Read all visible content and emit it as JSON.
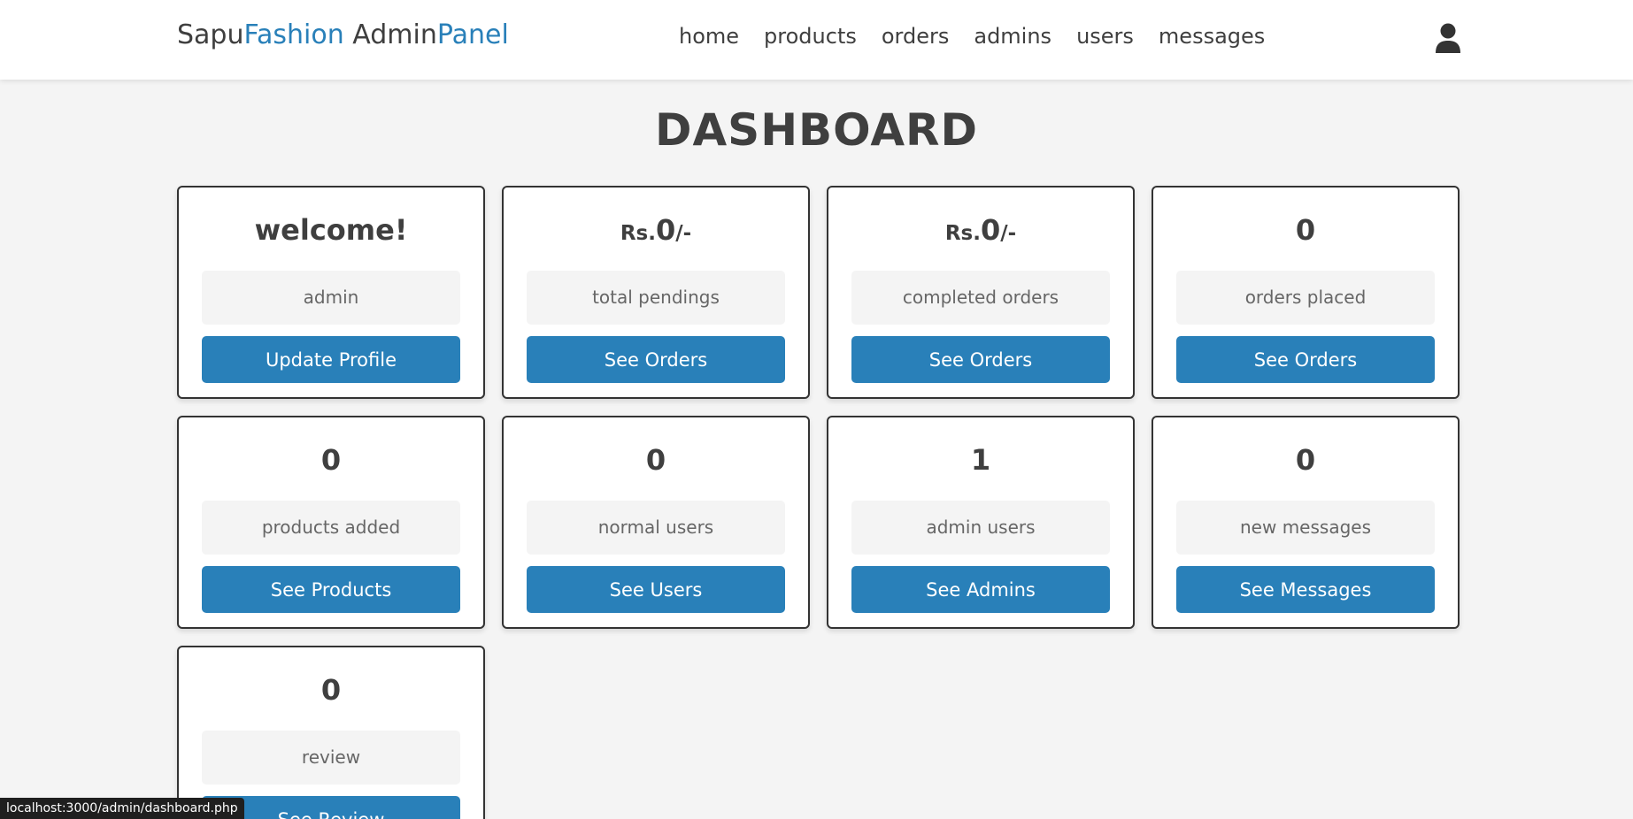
{
  "header": {
    "logo": {
      "part1": "Sapu",
      "part2": "Fashion",
      "part3": " Admin",
      "part4": "Panel"
    },
    "nav": [
      "home",
      "products",
      "orders",
      "admins",
      "users",
      "messages"
    ],
    "user_icon": "user-icon"
  },
  "page_title": "DASHBOARD",
  "cards": [
    {
      "value": "welcome!",
      "label": "admin",
      "button": "Update Profile"
    },
    {
      "prefix": "Rs.",
      "value": "0",
      "suffix": "/-",
      "label": "total pendings",
      "button": "See Orders"
    },
    {
      "prefix": "Rs.",
      "value": "0",
      "suffix": "/-",
      "label": "completed orders",
      "button": "See Orders"
    },
    {
      "value": "0",
      "label": "orders placed",
      "button": "See Orders"
    },
    {
      "value": "0",
      "label": "products added",
      "button": "See Products"
    },
    {
      "value": "0",
      "label": "normal users",
      "button": "See Users"
    },
    {
      "value": "1",
      "label": "admin users",
      "button": "See Admins"
    },
    {
      "value": "0",
      "label": "new messages",
      "button": "See Messages"
    },
    {
      "value": "0",
      "label": "review",
      "button": "See Review"
    }
  ],
  "status_bar": "localhost:3000/admin/dashboard.php",
  "colors": {
    "accent": "#2980b9",
    "text": "#3f3f3f",
    "background": "#f4f4f4"
  }
}
